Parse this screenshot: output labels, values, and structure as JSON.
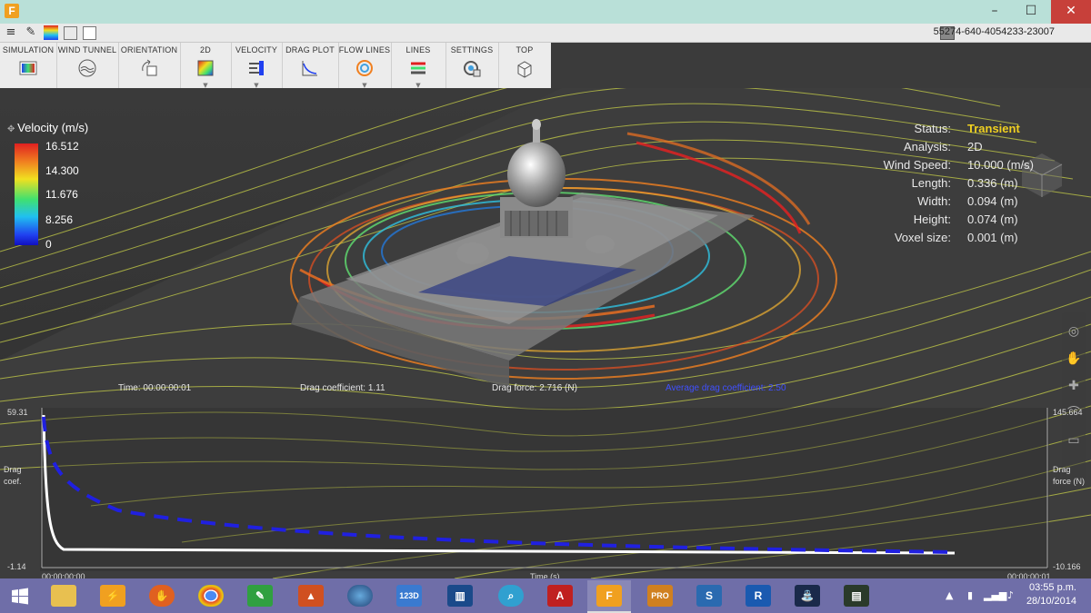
{
  "window": {
    "serial": "55274-640-4054233-23007",
    "minimize": "–",
    "maximize": "☐",
    "close": "✕"
  },
  "ribbon": [
    {
      "label": "SIMULATION",
      "icon": "simulation-icon"
    },
    {
      "label": "WIND TUNNEL",
      "icon": "wind-tunnel-icon"
    },
    {
      "label": "ORIENTATION",
      "icon": "orientation-icon"
    },
    {
      "label": "2D",
      "icon": "2d-slice-icon"
    },
    {
      "label": "VELOCITY",
      "icon": "velocity-icon"
    },
    {
      "label": "DRAG PLOT",
      "icon": "drag-plot-icon"
    },
    {
      "label": "FLOW LINES",
      "icon": "flow-lines-icon"
    },
    {
      "label": "LINES",
      "icon": "lines-icon"
    },
    {
      "label": "SETTINGS",
      "icon": "settings-icon"
    },
    {
      "label": "TOP",
      "icon": "top-view-cube-icon"
    }
  ],
  "legend": {
    "title": "Velocity (m/s)",
    "values": [
      "16.512",
      "14.300",
      "11.676",
      "8.256",
      "0"
    ],
    "colors": [
      "#e02020",
      "#f08020",
      "#f0e020",
      "#40e070",
      "#20c0f0",
      "#2040f0"
    ]
  },
  "status": [
    {
      "key": "Status:",
      "value": "Transient"
    },
    {
      "key": "Analysis:",
      "value": "2D"
    },
    {
      "key": "Wind Speed:",
      "value": "10.000 (m/s)"
    },
    {
      "key": "Length:",
      "value": "0.336 (m)"
    },
    {
      "key": "Width:",
      "value": "0.094 (m)"
    },
    {
      "key": "Height:",
      "value": "0.074 (m)"
    },
    {
      "key": "Voxel size:",
      "value": "0.001 (m)"
    }
  ],
  "plot": {
    "time": "Time: 00:00:00:01",
    "drag_coefficient": "Drag coefficient: 1.11",
    "drag_force": "Drag force: 2.716 (N)",
    "avg_drag": "Average drag coefficient: 2.50",
    "y_left_top": "59.31",
    "y_left_bottom": "-1.14",
    "y_left_label_1": "Drag",
    "y_left_label_2": "coef.",
    "y_right_top": "145.664",
    "y_right_bottom": "-10.166",
    "y_right_label_1": "Drag",
    "y_right_label_2": "force (N)",
    "x_left": "00:00:00:00",
    "x_right": "00:00:00:01",
    "x_label": "Time (s)",
    "line_colors": {
      "coefficient": "#ffffff",
      "force": "#2020e0"
    }
  },
  "taskbar": {
    "apps": [
      {
        "name": "start-icon"
      },
      {
        "name": "file-explorer-icon"
      },
      {
        "name": "vlc-icon"
      },
      {
        "name": "mitt-icon"
      },
      {
        "name": "chrome-icon"
      },
      {
        "name": "sketchbook-icon"
      },
      {
        "name": "matlab-icon"
      },
      {
        "name": "google-earth-icon"
      },
      {
        "name": "autodesk-123d-icon",
        "label": "123D"
      },
      {
        "name": "city-app-icon"
      },
      {
        "name": "search-app-icon"
      },
      {
        "name": "autocad-icon",
        "label": "A"
      },
      {
        "name": "flow-design-icon",
        "label": "F"
      },
      {
        "name": "autodesk-pro-icon",
        "label": "PRO"
      },
      {
        "name": "simulation-app-icon",
        "label": "S"
      },
      {
        "name": "revit-icon",
        "label": "R"
      },
      {
        "name": "water-tap-icon"
      },
      {
        "name": "flow-viewer-icon"
      }
    ],
    "time": "03:55 p.m.",
    "date": "28/10/2014"
  }
}
